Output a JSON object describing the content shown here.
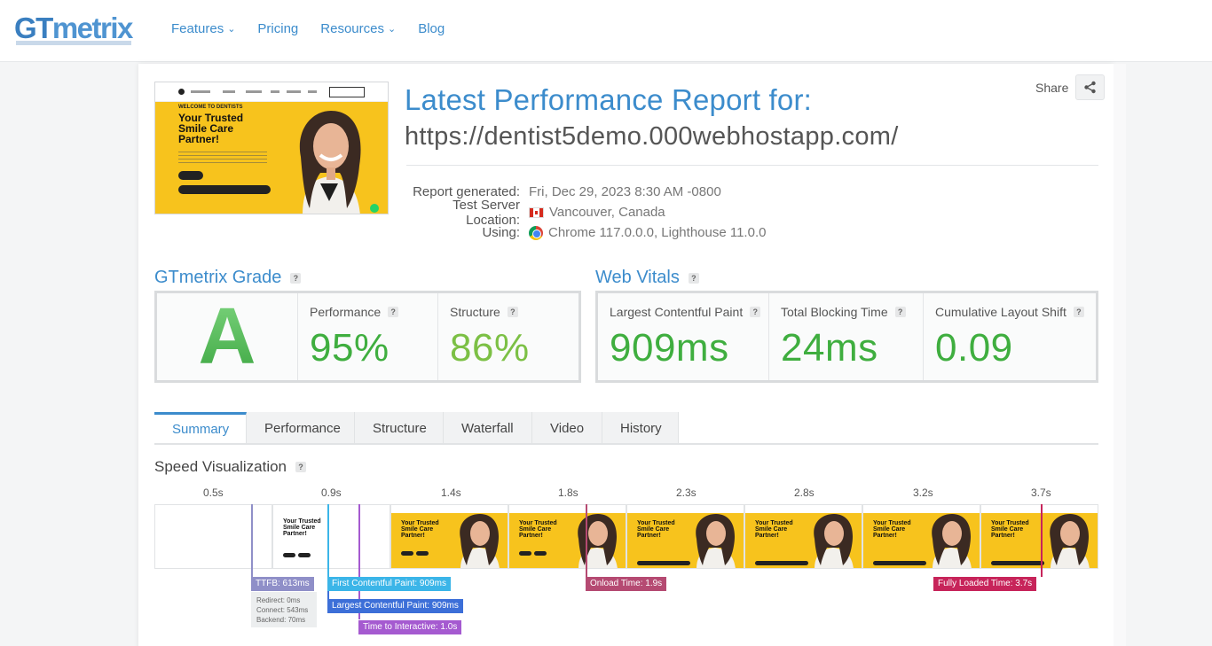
{
  "nav": {
    "logo_gt": "GT",
    "logo_metrix": "metrix",
    "items": [
      {
        "label": "Features",
        "dropdown": true
      },
      {
        "label": "Pricing",
        "dropdown": false
      },
      {
        "label": "Resources",
        "dropdown": true
      },
      {
        "label": "Blog",
        "dropdown": false
      }
    ]
  },
  "thumbnail": {
    "welcome": "WELCOME TO DENTISTS",
    "heading": "Your Trusted Smile Care Partner!"
  },
  "report": {
    "title": "Latest Performance Report for:",
    "url": "https://dentist5demo.000webhostapp.com/",
    "share_label": "Share",
    "meta": [
      {
        "key": "Report generated:",
        "value": "Fri, Dec 29, 2023 8:30 AM -0800",
        "icon": ""
      },
      {
        "key": "Test Server Location:",
        "value": "Vancouver, Canada",
        "icon": "canada-flag-icon"
      },
      {
        "key": "Using:",
        "value": "Chrome 117.0.0.0, Lighthouse 11.0.0",
        "icon": "chrome-icon"
      }
    ]
  },
  "grade": {
    "heading": "GTmetrix Grade",
    "letter": "A",
    "performance_label": "Performance",
    "performance_value": "95%",
    "structure_label": "Structure",
    "structure_value": "86%",
    "colors": {
      "performance": "#3fae3f",
      "structure": "#7cc045"
    }
  },
  "vitals": {
    "heading": "Web Vitals",
    "lcp_label": "Largest Contentful Paint",
    "lcp_value": "909ms",
    "tbt_label": "Total Blocking Time",
    "tbt_value": "24ms",
    "cls_label": "Cumulative Layout Shift",
    "cls_value": "0.09",
    "color": "#3fae3f"
  },
  "tabs": [
    "Summary",
    "Performance",
    "Structure",
    "Waterfall",
    "Video",
    "History"
  ],
  "active_tab": "Summary",
  "speed": {
    "heading": "Speed Visualization",
    "ticks": [
      "0.5s",
      "0.9s",
      "1.4s",
      "1.8s",
      "2.3s",
      "2.8s",
      "3.2s",
      "3.7s"
    ],
    "markers": {
      "ttfb": "TTFB: 613ms",
      "fcp": "First Contentful Paint: 909ms",
      "lcp": "Largest Contentful Paint: 909ms",
      "tti": "Time to Interactive: 1.0s",
      "onload": "Onload Time: 1.9s",
      "fully_loaded": "Fully Loaded Time: 3.7s"
    },
    "ttfb_breakdown": {
      "redirect": "Redirect: 0ms",
      "connect": "Connect: 543ms",
      "backend": "Backend: 70ms"
    },
    "frame_text": "Your Trusted Smile Care Partner!",
    "colors": {
      "ttfb": "#8f8fc8",
      "fcp": "#3bb5e8",
      "lcp": "#3c6fd8",
      "tti": "#a55ad0",
      "onload": "#b54a72",
      "fully_loaded": "#c7245a"
    }
  }
}
